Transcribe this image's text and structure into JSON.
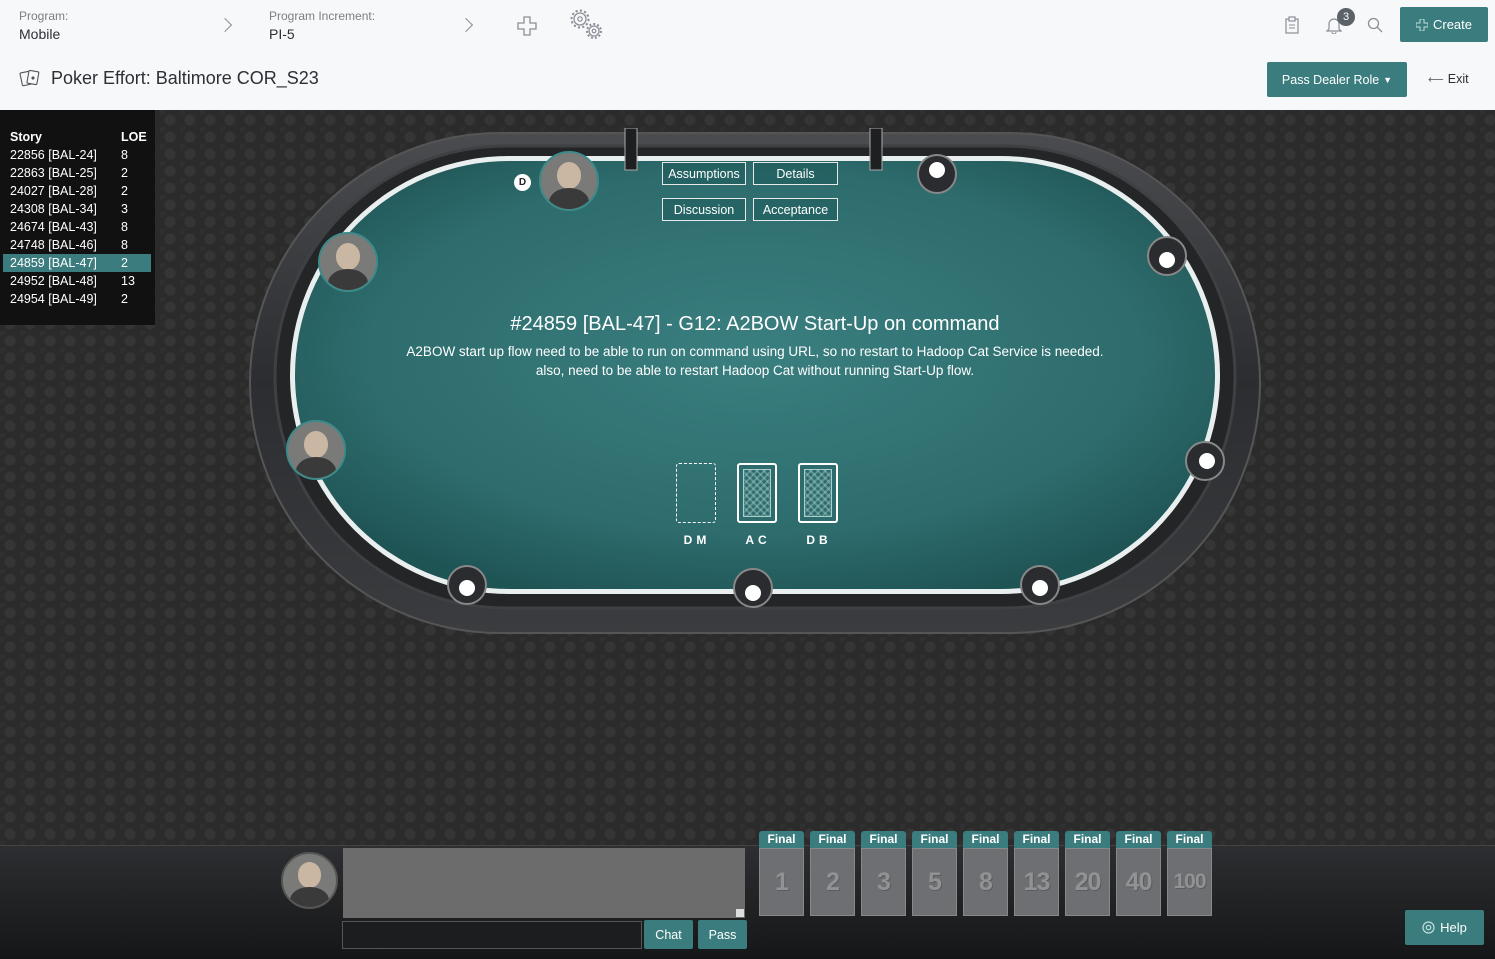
{
  "header": {
    "program_label": "Program:",
    "program_value": "Mobile",
    "increment_label": "Program Increment:",
    "increment_value": "PI-5",
    "notification_count": "3",
    "create_label": "Create",
    "title": "Poker Effort: Baltimore COR_S23",
    "pass_dealer_label": "Pass Dealer Role",
    "exit_label": "Exit"
  },
  "stories": {
    "col_story": "Story",
    "col_loe": "LOE",
    "rows": [
      {
        "id": "22856 [BAL-24]",
        "loe": "8"
      },
      {
        "id": "22863 [BAL-25]",
        "loe": "2"
      },
      {
        "id": "24027 [BAL-28]",
        "loe": "2"
      },
      {
        "id": "24308 [BAL-34]",
        "loe": "3"
      },
      {
        "id": "24674 [BAL-43]",
        "loe": "8"
      },
      {
        "id": "24748 [BAL-46]",
        "loe": "8"
      },
      {
        "id": "24859 [BAL-47]",
        "loe": "2"
      },
      {
        "id": "24952 [BAL-48]",
        "loe": "13"
      },
      {
        "id": "24954 [BAL-49]",
        "loe": "2"
      }
    ],
    "selected_index": 6
  },
  "table": {
    "buttons": {
      "assumptions": "Assumptions",
      "details": "Details",
      "discussion": "Discussion",
      "acceptance": "Acceptance"
    },
    "dealer_chip": "D",
    "story_title": "#24859 [BAL-47] - G12: A2BOW Start-Up on command",
    "story_description": "A2BOW start up flow need to be able to run on command using URL, so no restart to Hadoop Cat Service is needed. also, need to be able to restart Hadoop Cat without running Start-Up flow.",
    "cards": [
      {
        "name": "DM",
        "state": "empty"
      },
      {
        "name": "AC",
        "state": "played"
      },
      {
        "name": "DB",
        "state": "played"
      }
    ]
  },
  "chat": {
    "chat_button": "Chat",
    "pass_button": "Pass"
  },
  "votes": {
    "tab_label": "Final",
    "values": [
      "1",
      "2",
      "3",
      "5",
      "8",
      "13",
      "20",
      "40",
      "100"
    ]
  },
  "help_label": "Help",
  "colors": {
    "accent": "#3b7d7e",
    "felt": "#2f6d6e",
    "background": "#2b2b2b"
  }
}
